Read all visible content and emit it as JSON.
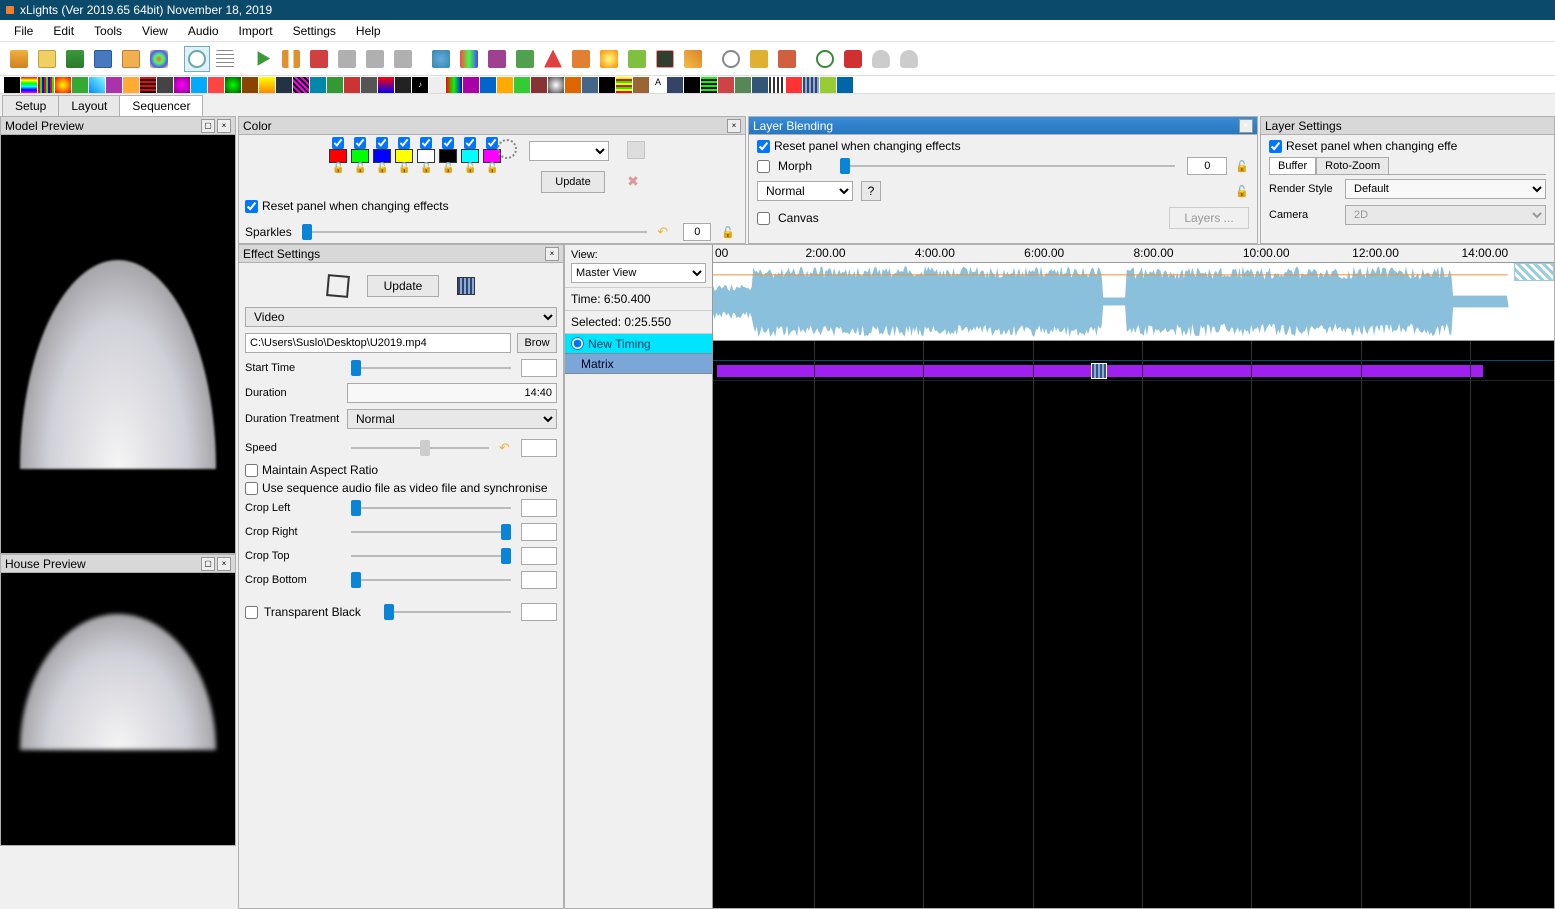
{
  "window_title": "xLights (Ver 2019.65 64bit) November 18, 2019",
  "menubar": [
    "File",
    "Edit",
    "Tools",
    "View",
    "Audio",
    "Import",
    "Settings",
    "Help"
  ],
  "main_tabs": [
    "Setup",
    "Layout",
    "Sequencer"
  ],
  "panels": {
    "model_preview": "Model Preview",
    "house_preview": "House Preview",
    "color": "Color",
    "effect_settings": "Effect Settings",
    "layer_blending": "Layer Blending",
    "layer_settings": "Layer Settings"
  },
  "color": {
    "reset_label": "Reset panel when changing effects",
    "update_btn": "Update",
    "sparkles_label": "Sparkles",
    "sparkles_value": "0",
    "swatches": [
      "#ff0000",
      "#00ff00",
      "#0000ff",
      "#ffff00",
      "#ffffff",
      "#000000",
      "#00ffff",
      "#ff00ff"
    ]
  },
  "effect_settings": {
    "update_btn": "Update",
    "effect_type": "Video",
    "path": "C:\\Users\\Suslo\\Desktop\\U2019.mp4",
    "browse_btn": "Brow",
    "start_time_label": "Start Time",
    "duration_label": "Duration",
    "duration_value": "14:40",
    "duration_treatment_label": "Duration Treatment",
    "duration_treatment": "Normal",
    "speed_label": "Speed",
    "maintain_aspect": "Maintain Aspect Ratio",
    "use_sequence_audio": "Use sequence audio file as video file and synchronise",
    "crop_left": "Crop Left",
    "crop_right": "Crop Right",
    "crop_top": "Crop Top",
    "crop_bottom": "Crop Bottom",
    "transparent_black": "Transparent Black"
  },
  "layer_blending": {
    "reset_label": "Reset panel when changing effects",
    "morph_label": "Morph",
    "morph_value": "0",
    "mode": "Normal",
    "q": "?",
    "canvas_label": "Canvas",
    "layers_btn": "Layers ..."
  },
  "layer_settings": {
    "reset_label": "Reset panel when changing effe",
    "tabs": [
      "Buffer",
      "Roto-Zoom"
    ],
    "render_style_label": "Render Style",
    "render_style": "Default",
    "camera_label": "Camera",
    "camera": "2D"
  },
  "timeline": {
    "view_label": "View:",
    "view": "Master View",
    "time_label": "Time: 6:50.400",
    "selected_label": "Selected: 0:25.550",
    "timing_row": "New Timing",
    "model_row": "Matrix",
    "ruler_marks": [
      {
        "label": "2:00.00",
        "pct": 11
      },
      {
        "label": "4:00.00",
        "pct": 24
      },
      {
        "label": "6:00.00",
        "pct": 37
      },
      {
        "label": "8:00.00",
        "pct": 50
      },
      {
        "label": "10:00.00",
        "pct": 63
      },
      {
        "label": "12:00.00",
        "pct": 76
      },
      {
        "label": "14:00.00",
        "pct": 89
      }
    ]
  }
}
